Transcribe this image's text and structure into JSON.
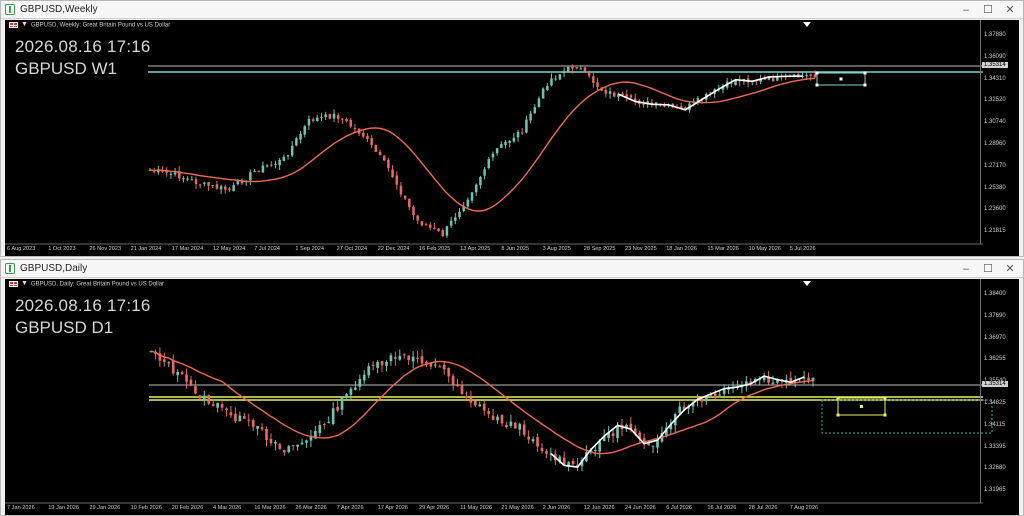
{
  "windows": [
    {
      "id": "weekly",
      "title": "GBPUSD,Weekly",
      "header": "GBPUSD, Weekly:  Great Britain Pound vs US Dollar",
      "overlay_datetime": "2026.08.16 17:16",
      "overlay_symbol": "GBPUSD W1",
      "current_price": "1.35314",
      "price_labels": [
        "1.37880",
        "1.36090",
        "1.34310",
        "1.32520",
        "1.30740",
        "1.28960",
        "1.27170",
        "1.25380",
        "1.23600",
        "1.21815"
      ],
      "time_labels": [
        "6 Aug 2023",
        "1 Oct 2023",
        "26 Nov 2023",
        "21 Jan 2024",
        "17 Mar 2024",
        "12 May 2024",
        "7 Jul 2024",
        "1 Sep 2024",
        "27 Oct 2024",
        "22 Dec 2024",
        "16 Feb 2025",
        "13 Apr 2025",
        "8 Jun 2025",
        "3 Aug 2025",
        "28 Sep 2025",
        "23 Nov 2025",
        "18 Jan 2026",
        "15 Mar 2026",
        "10 May 2026",
        "5 Jul 2026"
      ],
      "buttons": {
        "minimize": "–",
        "maximize": "☐",
        "close": "✕"
      },
      "colors": {
        "bull": "#6fc3b3",
        "bear": "#e8695f",
        "ma": "#f06a50",
        "zigzag": "#ffffff",
        "level": "#7fd6d0"
      }
    },
    {
      "id": "daily",
      "title": "GBPUSD,Daily",
      "header": "GBPUSD, Daily:  Great Britain Pound vs US Dollar",
      "overlay_datetime": "2026.08.16 17:16",
      "overlay_symbol": "GBPUSD D1",
      "current_price": "1.35314",
      "price_labels": [
        "1.38400",
        "1.37690",
        "1.36970",
        "1.36255",
        "1.35540",
        "1.34825",
        "1.34115",
        "1.33395",
        "1.32680",
        "1.31965"
      ],
      "time_labels": [
        "7 Jan 2026",
        "19 Jan 2026",
        "29 Jan 2026",
        "10 Feb 2026",
        "20 Feb 2026",
        "4 Mar 2026",
        "16 Mar 2026",
        "26 Mar 2026",
        "7 Apr 2026",
        "17 Apr 2026",
        "29 Apr 2026",
        "11 May 2026",
        "21 May 2026",
        "2 Jun 2026",
        "12 Jun 2026",
        "24 Jun 2026",
        "6 Jul 2026",
        "16 Jul 2026",
        "28 Jul 2026",
        "7 Aug 2026"
      ],
      "buttons": {
        "minimize": "–",
        "maximize": "☐",
        "close": "✕"
      },
      "colors": {
        "bull": "#6fc3b3",
        "bear": "#e8695f",
        "ma": "#f06a50",
        "zigzag": "#ffffff",
        "level": "#e8f060"
      }
    }
  ]
}
